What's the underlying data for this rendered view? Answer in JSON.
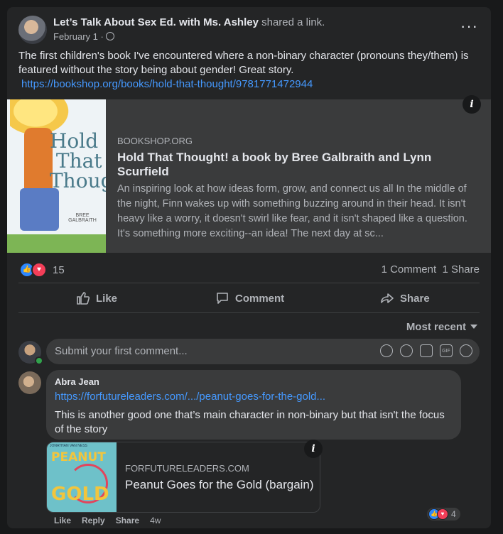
{
  "post": {
    "author": "Let’s Talk About Sex Ed. with Ms. Ashley",
    "action": "shared a link.",
    "date": "February 1",
    "date_sep": "·",
    "menu_icon": "more-dots-icon",
    "text": "The first children's book I've encountered where a non-binary character (pronouns they/them) is featured without the story being about gender! Great story.",
    "link": "https://bookshop.org/books/hold-that-thought/9781771472944"
  },
  "preview": {
    "domain": "BOOKSHOP.ORG",
    "title": "Hold That Thought! a book by Bree Galbraith and Lynn Scurfield",
    "description": "An inspiring look at how ideas form, grow, and connect us all In the middle of the night, Finn wakes up with something buzzing around in their head. It isn't heavy like a worry, it doesn't swirl like fear, and it isn't shaped like a question. It's something more exciting--an idea! The next day at sc...",
    "cover_title": "Hold That Thought",
    "cover_author": "BREE GALBRAITH",
    "info_icon": "i"
  },
  "stats": {
    "reactions": "15",
    "comments": "1 Comment",
    "shares": "1 Share"
  },
  "actions": {
    "like": "Like",
    "comment": "Comment",
    "share": "Share"
  },
  "sort": {
    "label": "Most recent"
  },
  "composer": {
    "placeholder": "Submit your first comment...",
    "gif": "GIF"
  },
  "comment": {
    "author": "Abra Jean",
    "link": "https://forfutureleaders.com/.../peanut-goes-for-the-gold...",
    "text": "This is another good one that’s main character in non-binary but that isn't the focus of the story",
    "preview_domain": "FORFUTURELEADERS.COM",
    "preview_title": "Peanut Goes for the Gold (bargain)",
    "cover_top": "JONATHAN VAN NESS",
    "cover_line1": "PEANUT",
    "cover_line2": "GOLD",
    "like": "Like",
    "reply": "Reply",
    "share": "Share",
    "time": "4w",
    "reactions": "4"
  },
  "colors": {
    "background": "#18191a",
    "card": "#242526",
    "link": "#4599ff",
    "like_blue": "#2d88ff",
    "love_red": "#f33e58"
  }
}
